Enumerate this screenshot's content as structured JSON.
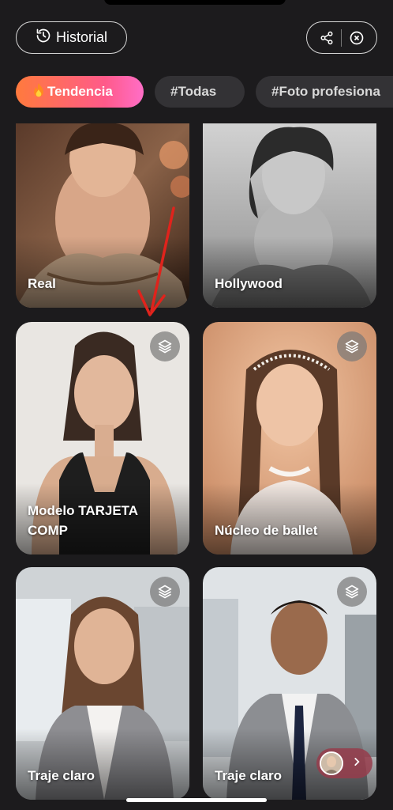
{
  "topbar": {
    "history_label": "Historial",
    "history_icon": "history-icon",
    "share_icon": "share-icon",
    "close_icon": "close-circle-icon"
  },
  "tabs": [
    {
      "label": "Tendencia",
      "icon": "flame-icon",
      "active": true
    },
    {
      "label": "#Todas",
      "active": false
    },
    {
      "label": "#Foto profesiona",
      "active": false
    }
  ],
  "cards": [
    {
      "label": "Real",
      "multi": false
    },
    {
      "label": "Hollywood",
      "multi": false
    },
    {
      "label": "Modelo TARJETA COMP",
      "multi": true
    },
    {
      "label": "Núcleo de ballet",
      "multi": true
    },
    {
      "label": "Traje claro",
      "multi": true
    },
    {
      "label": "Traje claro",
      "multi": true
    }
  ],
  "colors": {
    "background": "#1c1b1d",
    "accent_start": "#ff7a3d",
    "accent_end": "#ff6ec7",
    "tab_inactive": "#333235"
  }
}
